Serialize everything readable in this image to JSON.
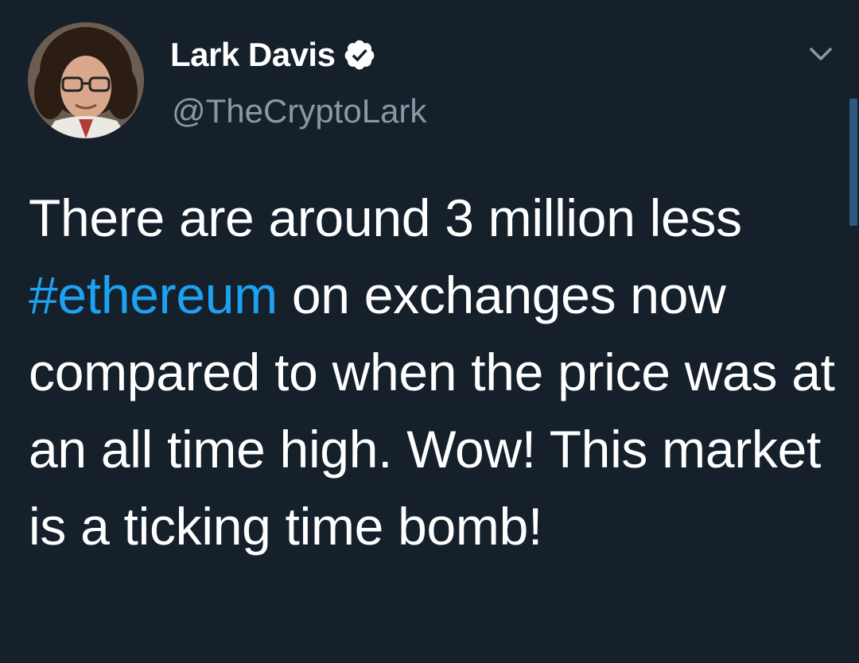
{
  "tweet": {
    "author": {
      "display_name": "Lark Davis",
      "handle": "@TheCryptoLark",
      "verified": true,
      "avatar_icon": "profile-photo"
    },
    "menu_icon": "chevron-down-icon",
    "text_before_hashtag": "There are around 3 million less ",
    "hashtag": "#ethereum",
    "text_after_hashtag": " on exchanges now compared to when the price was at an all time high. Wow! This market is a ticking time bomb!"
  },
  "colors": {
    "background": "#15202b",
    "text": "#ffffff",
    "secondary_text": "#8899a6",
    "accent": "#1da1f2"
  }
}
